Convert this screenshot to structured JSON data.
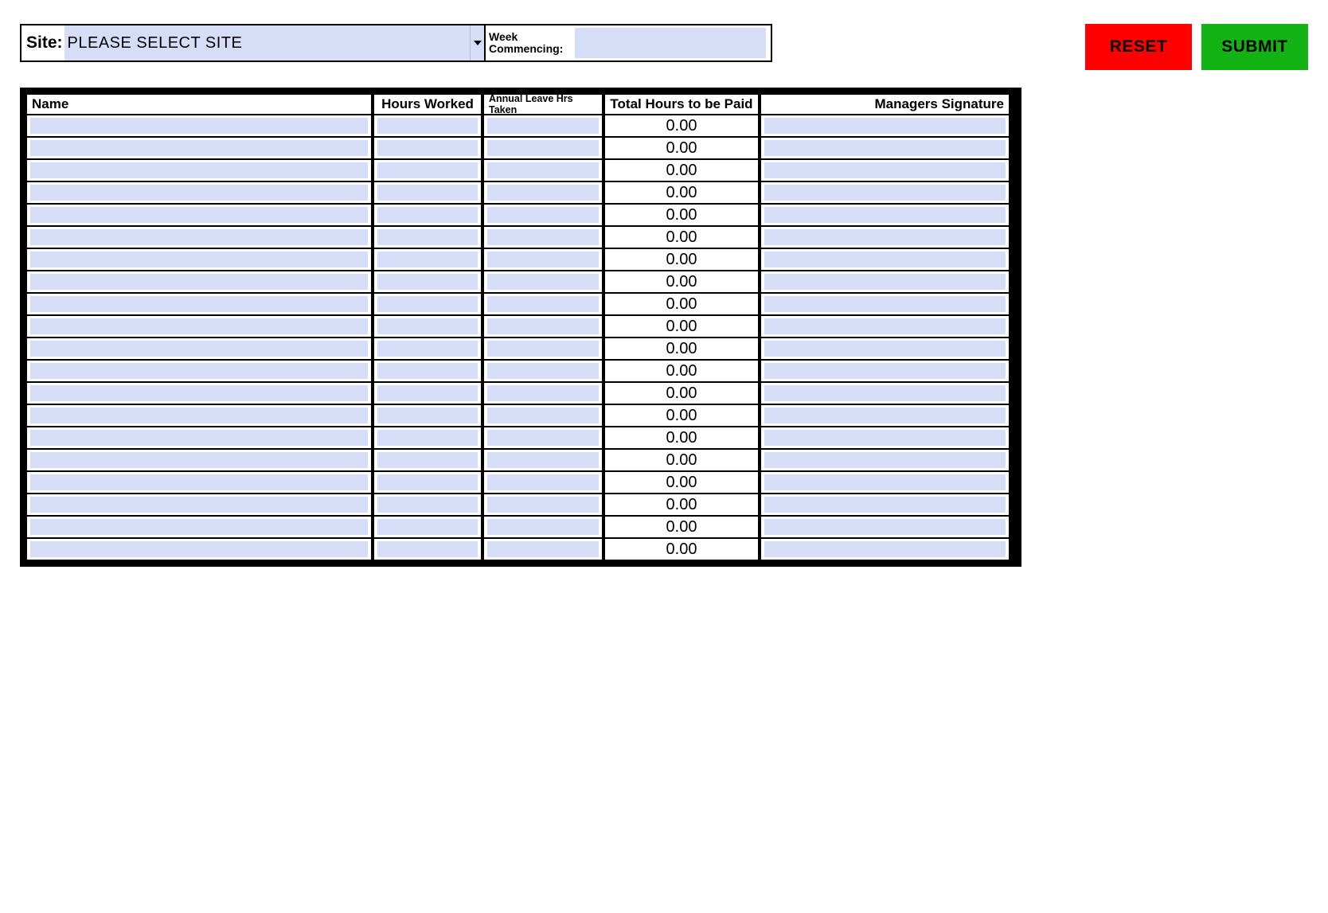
{
  "header": {
    "site_label": "Site:",
    "site_value": "PLEASE SELECT SITE",
    "week_label": "Week Commencing:",
    "week_value": ""
  },
  "buttons": {
    "reset_label": "RESET",
    "submit_label": "SUBMIT"
  },
  "columns": {
    "name": "Name",
    "hours": "Hours Worked",
    "annual_leave": "Annual Leave Hrs Taken",
    "total": "Total Hours to be Paid",
    "signature": "Managers Signature"
  },
  "rows": [
    {
      "name": "",
      "hours": "",
      "annual_leave": "",
      "total": "0.00",
      "signature": ""
    },
    {
      "name": "",
      "hours": "",
      "annual_leave": "",
      "total": "0.00",
      "signature": ""
    },
    {
      "name": "",
      "hours": "",
      "annual_leave": "",
      "total": "0.00",
      "signature": ""
    },
    {
      "name": "",
      "hours": "",
      "annual_leave": "",
      "total": "0.00",
      "signature": ""
    },
    {
      "name": "",
      "hours": "",
      "annual_leave": "",
      "total": "0.00",
      "signature": ""
    },
    {
      "name": "",
      "hours": "",
      "annual_leave": "",
      "total": "0.00",
      "signature": ""
    },
    {
      "name": "",
      "hours": "",
      "annual_leave": "",
      "total": "0.00",
      "signature": ""
    },
    {
      "name": "",
      "hours": "",
      "annual_leave": "",
      "total": "0.00",
      "signature": ""
    },
    {
      "name": "",
      "hours": "",
      "annual_leave": "",
      "total": "0.00",
      "signature": ""
    },
    {
      "name": "",
      "hours": "",
      "annual_leave": "",
      "total": "0.00",
      "signature": ""
    },
    {
      "name": "",
      "hours": "",
      "annual_leave": "",
      "total": "0.00",
      "signature": ""
    },
    {
      "name": "",
      "hours": "",
      "annual_leave": "",
      "total": "0.00",
      "signature": ""
    },
    {
      "name": "",
      "hours": "",
      "annual_leave": "",
      "total": "0.00",
      "signature": ""
    },
    {
      "name": "",
      "hours": "",
      "annual_leave": "",
      "total": "0.00",
      "signature": ""
    },
    {
      "name": "",
      "hours": "",
      "annual_leave": "",
      "total": "0.00",
      "signature": ""
    },
    {
      "name": "",
      "hours": "",
      "annual_leave": "",
      "total": "0.00",
      "signature": ""
    },
    {
      "name": "",
      "hours": "",
      "annual_leave": "",
      "total": "0.00",
      "signature": ""
    },
    {
      "name": "",
      "hours": "",
      "annual_leave": "",
      "total": "0.00",
      "signature": ""
    },
    {
      "name": "",
      "hours": "",
      "annual_leave": "",
      "total": "0.00",
      "signature": ""
    },
    {
      "name": "",
      "hours": "",
      "annual_leave": "",
      "total": "0.00",
      "signature": ""
    }
  ]
}
